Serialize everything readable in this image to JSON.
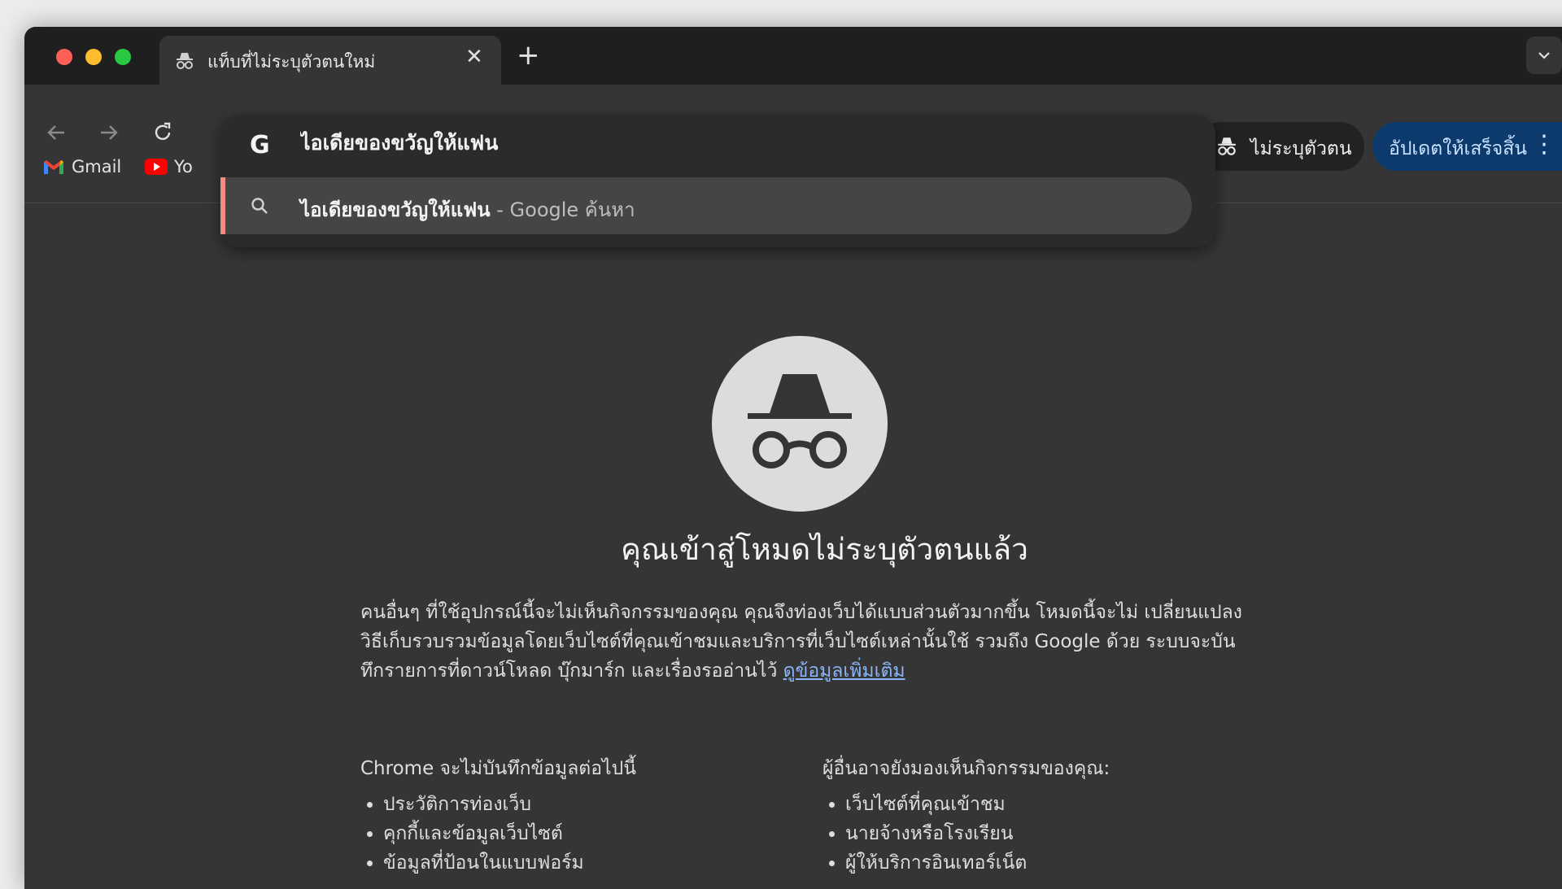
{
  "tab": {
    "title": "แท็บที่ไม่ระบุตัวตนใหม่",
    "close": "✕",
    "icon": "incognito-icon"
  },
  "new_tab_symbol": "+",
  "toolbar": {
    "incognito_label": "ไม่ระบุตัวตน",
    "update_label": "อัปเดตให้เสร็จสิ้น",
    "menu_symbol": "⋮"
  },
  "bookmarks": [
    {
      "label": "Gmail",
      "icon": "gmail-icon"
    },
    {
      "label": "Yo",
      "icon": "youtube-icon"
    }
  ],
  "omnibox": {
    "g_logo": "G",
    "input_value": "ไอเดียของขวัญให้แฟน",
    "suggestion_query": "ไอเดียของขวัญให้แฟน",
    "suggestion_suffix": " - Google ค้นหา"
  },
  "page": {
    "heading": "คุณเข้าสู่โหมดไม่ระบุตัวตนแล้ว",
    "paragraph": "คนอื่นๆ ที่ใช้อุปกรณ์นี้จะไม่เห็นกิจกรรมของคุณ คุณจึงท่องเว็บได้แบบส่วนตัวมากขึ้น โหมดนี้จะไม่ เปลี่ยนแปลงวิธีเก็บรวบรวมข้อมูลโดยเว็บไซต์ที่คุณเข้าชมและบริการที่เว็บไซต์เหล่านั้นใช้ รวมถึง Google ด้วย ระบบจะบันทึกรายการที่ดาวน์โหลด บุ๊กมาร์ก และเรื่องรออ่านไว้",
    "learn_more": "ดูข้อมูลเพิ่มเติม",
    "left_title": "Chrome จะไม่บันทึกข้อมูลต่อไปนี้",
    "left_items": [
      "ประวัติการท่องเว็บ",
      "คุกกี้และข้อมูลเว็บไซต์",
      "ข้อมูลที่ป้อนในแบบฟอร์ม"
    ],
    "right_title": "ผู้อื่นอาจยังมองเห็นกิจกรรมของคุณ:",
    "right_items": [
      "เว็บไซต์ที่คุณเข้าชม",
      "นายจ้างหรือโรงเรียน",
      "ผู้ให้บริการอินเทอร์เน็ต"
    ]
  },
  "colors": {
    "tabstrip": "#1f1f1f",
    "toolbar": "#353535",
    "update_chip": "#0c3a6d",
    "suggestion_accent": "#f28b82",
    "link": "#8ab4f8"
  }
}
